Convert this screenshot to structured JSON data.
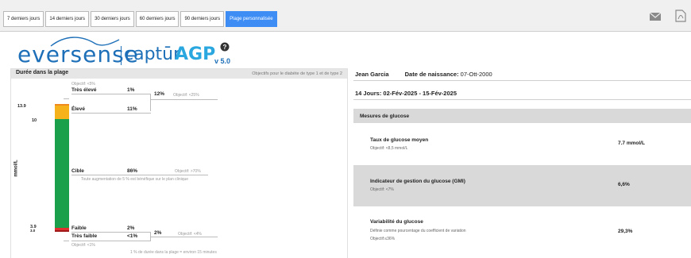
{
  "toolbar": {
    "tabs": [
      {
        "label": "7 derniers jours",
        "active": false
      },
      {
        "label": "14 derniers jours",
        "active": false
      },
      {
        "label": "30 derniers jours",
        "active": false
      },
      {
        "label": "60 derniers jours",
        "active": false
      },
      {
        "label": "90 derniers jours",
        "active": false
      },
      {
        "label": "Plage personnalisée",
        "active": true
      }
    ],
    "icons": [
      "mail-icon",
      "pdf-icon"
    ]
  },
  "logo": {
    "brand": "eversense",
    "product_prefix": "captūr",
    "product_suffix": "AGP",
    "version": "v 5.0"
  },
  "time_in_range": {
    "title": "Durée dans la plage",
    "subtitle": "Objectifs pour le diabète de type 1 et de type 2",
    "unit_axis": "mmol/L",
    "thresholds": {
      "high": "13.9",
      "low_high": "10",
      "low": "3.9",
      "very_low": "3.0"
    },
    "very_high": {
      "target": "Objectif: <5%",
      "label": "Très élevé",
      "value": "1%"
    },
    "high_combined": {
      "value": "12%",
      "target": "Objectif: <25%"
    },
    "high": {
      "label": "Élevé",
      "value": "11%"
    },
    "target": {
      "label": "Cible",
      "value": "86%",
      "target": "Objectif: >70%",
      "note": "Toute augmentation de 5 % est bénéfique sur le plan clinique"
    },
    "low": {
      "label": "Faible",
      "value": "2%"
    },
    "low_combined": {
      "value": "2%",
      "target": "Objectif: <4%"
    },
    "very_low": {
      "label": "Très faible",
      "value": "<1%",
      "target": "Objectif: <1%"
    },
    "footnote": "1 % de durée dans la plage = environ 15 minutes",
    "colors": {
      "very_high": "#f08a1e",
      "high": "#f5b21b",
      "target": "#1aa04a",
      "low": "#e03030",
      "very_low": "#a01818"
    }
  },
  "patient": {
    "name": "Jean Garcia",
    "dob_label": "Date de naissance:",
    "dob": "07-Ott-2000"
  },
  "period": "14 Jours: 02-Fév-2025 - 15-Fév-2025",
  "metrics": {
    "title": "Mesures de glucose",
    "items": [
      {
        "name": "Taux de glucose moyen",
        "desc": "Objectif: <8,5 mmol/L",
        "desc2": "",
        "value": "7.7 mmol/L"
      },
      {
        "name": "Indicateur de gestion du glucose (GMI)",
        "desc": "Objectif: <7%",
        "desc2": "",
        "value": "6,6%"
      },
      {
        "name": "Variabilité du glucose",
        "desc": "Définie comme pourcentage du coefficient de variation",
        "desc2": "Objectif:≤36%",
        "value": "29,3%"
      }
    ]
  }
}
